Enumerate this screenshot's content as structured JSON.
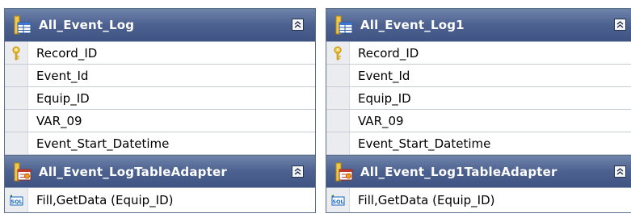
{
  "panels": [
    {
      "table": {
        "title": "All_Event_Log",
        "columns": [
          "Record_ID",
          "Event_Id",
          "Equip_ID",
          "VAR_09",
          "Event_Start_Datetime"
        ],
        "key_column_index": 0
      },
      "adapter": {
        "title": "All_Event_LogTableAdapter",
        "query": "Fill,GetData (Equip_ID)"
      }
    },
    {
      "table": {
        "title": "All_Event_Log1",
        "columns": [
          "Record_ID",
          "Event_Id",
          "Equip_ID",
          "VAR_09",
          "Event_Start_Datetime"
        ],
        "key_column_index": 0
      },
      "adapter": {
        "title": "All_Event_Log1TableAdapter",
        "query": "Fill,GetData (Equip_ID)"
      }
    }
  ],
  "colors": {
    "header_top": "#6f84aa",
    "header_bottom": "#3f5482",
    "gutter": "#ebecef",
    "key": "#e3b82f"
  },
  "icons": {
    "table": "table-icon",
    "key": "key-icon",
    "adapter": "table-adapter-icon",
    "sql": "sql-query-icon",
    "collapse": "collapse-chevrons-icon"
  }
}
